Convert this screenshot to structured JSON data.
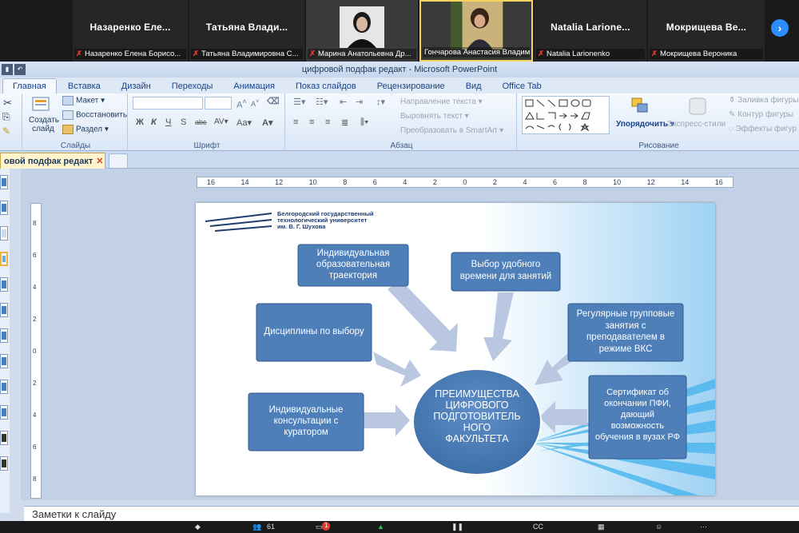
{
  "zoom": {
    "participants": [
      {
        "name": "Назаренко Еле...",
        "label": "Назаренко Елена Борисо..."
      },
      {
        "name": "Татьяна Влади...",
        "label": "Татьяна Владимировна С..."
      },
      {
        "name": "",
        "label": "Марина Анатольевна Др..."
      },
      {
        "name": "",
        "label": "Гончарова Анастасия Владимир..."
      },
      {
        "name": "Natalia Larione...",
        "label": "Natalia Larionenko"
      },
      {
        "name": "Мокрищева Ве...",
        "label": "Мокрищева Вероника"
      }
    ],
    "next_arrow": "›",
    "bottom": {
      "participants_count": "61",
      "chat_badge": "1"
    }
  },
  "ppt": {
    "window_title": "цифровой подфак редакт  -  Microsoft PowerPoint",
    "tabs": [
      "Главная",
      "Вставка",
      "Дизайн",
      "Переходы",
      "Анимация",
      "Показ слайдов",
      "Рецензирование",
      "Вид",
      "Office Tab"
    ],
    "groups": {
      "slides": "Слайды",
      "font": "Шрифт",
      "paragraph": "Абзац",
      "drawing": "Рисование"
    },
    "ribbon": {
      "create_slide": "Создать слайд",
      "layout": "Макет",
      "reset": "Восстановить",
      "section": "Раздел",
      "text_direction": "Направление текста",
      "align_text": "Выровнять текст",
      "convert_smartart": "Преобразовать в SmartArt",
      "arrange": "Упорядочить",
      "quick_styles": "Экспресс-стили",
      "shape_fill": "Заливка фигуры",
      "shape_outline": "Контур фигуры",
      "shape_effects": "Эффекты фигур"
    },
    "doc_tab": "овой подфак редакт",
    "doc_tab_close": "✕",
    "ruler_h": [
      "16",
      "14",
      "12",
      "10",
      "8",
      "6",
      "4",
      "2",
      "0",
      "2",
      "4",
      "6",
      "8",
      "10",
      "12",
      "14",
      "16"
    ],
    "ruler_v": [
      "8",
      "6",
      "4",
      "2",
      "0",
      "2",
      "4",
      "6",
      "8"
    ],
    "notes_placeholder": "Заметки к слайду"
  },
  "slide": {
    "university": [
      "Белгородский государственный",
      "технологический университет",
      "им. В. Г. Шухова"
    ],
    "center": [
      "ПРЕИМУЩЕСТВА",
      "ЦИФРОВОГО",
      "ПОДГОТОВИТЕЛЬ",
      "НОГО",
      "ФАКУЛЬТЕТА"
    ],
    "boxes": {
      "trajectory": [
        "Индивидуальная",
        "образовательная",
        "траектория"
      ],
      "time": [
        "Выбор удобного",
        "времени для занятий"
      ],
      "disciplines": [
        "Дисциплины по выбору"
      ],
      "group": [
        "Регулярные групповые",
        "занятия с",
        "преподавателем  в",
        "режиме ВКС"
      ],
      "consult": [
        "Индивидуальные",
        "консультации с",
        "куратором"
      ],
      "cert": [
        "Сертификат об",
        "окончании ПФИ,",
        "дающий",
        "возможность",
        "обучения в вузах РФ"
      ]
    },
    "colors": {
      "box": "#4f7fb8",
      "box_border": "#2f5a8f",
      "arrow": "#b9c7e0",
      "bg_accent": "#8cc8f0"
    }
  }
}
